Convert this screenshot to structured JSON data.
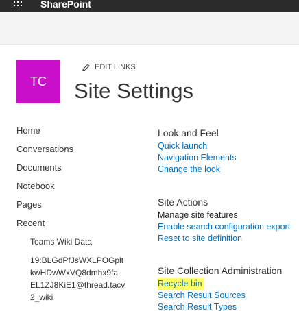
{
  "suite_bar": {
    "brand": "SharePoint",
    "background": "#2b2b2b"
  },
  "site": {
    "logo_initials": "TC",
    "logo_color": "#c90fc9",
    "edit_links_label": "EDIT LINKS",
    "page_title": "Site Settings"
  },
  "left_nav": {
    "items": [
      "Home",
      "Conversations",
      "Documents",
      "Notebook",
      "Pages",
      "Recent"
    ],
    "recent": {
      "first": "Teams Wiki Data",
      "second_lines": [
        "19:BLGdPfJsWXLPOGplt",
        "kwHDwWxVQ8dmhx9fa",
        "EL1ZJ8KiE1@thread.tacv",
        "2_wiki"
      ]
    }
  },
  "sections": {
    "look_and_feel": {
      "heading": "Look and Feel",
      "links": [
        "Quick launch",
        "Navigation Elements",
        "Change the look"
      ]
    },
    "site_actions": {
      "heading": "Site Actions",
      "items": [
        "Manage site features",
        "Enable search configuration export",
        "Reset to site definition"
      ]
    },
    "site_collection_admin": {
      "heading": "Site Collection Administration",
      "links": [
        "Recycle bin",
        "Search Result Sources",
        "Search Result Types"
      ],
      "highlight_color": "#ffff66"
    }
  },
  "colors": {
    "link": "#0072c6",
    "text": "#333333",
    "command_bar": "#f4f4f4"
  },
  "icons": {
    "app_launcher": "waffle-icon",
    "edit": "pencil-icon"
  }
}
